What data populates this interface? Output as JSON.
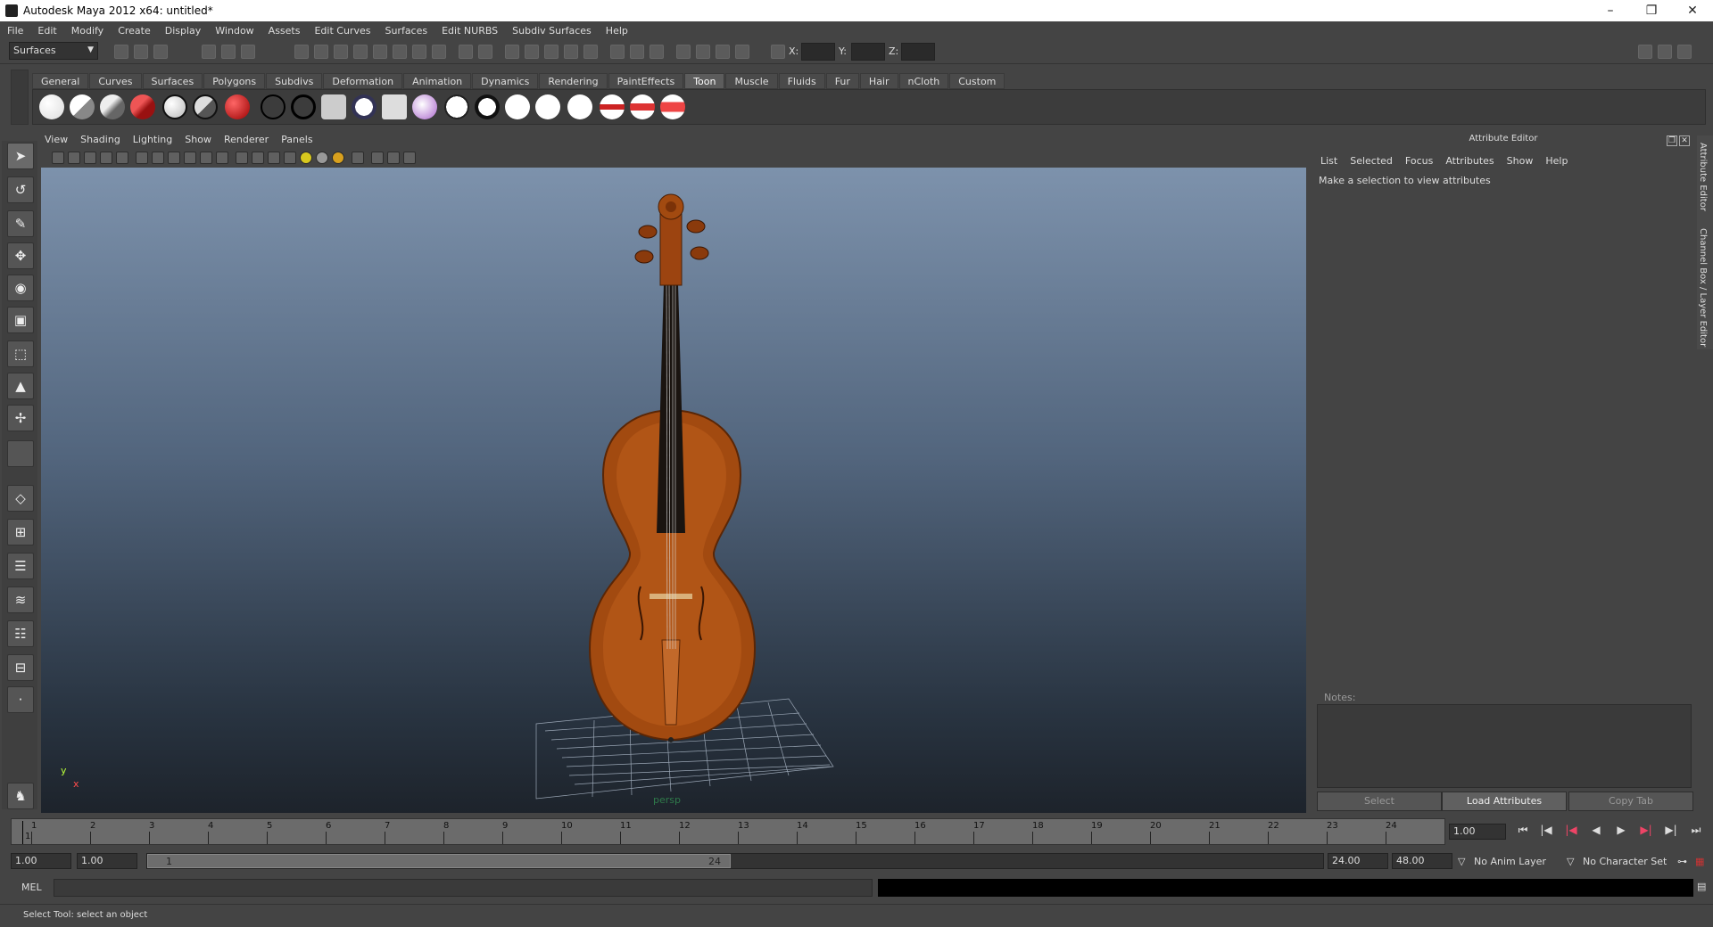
{
  "window": {
    "title": "Autodesk Maya 2012 x64: untitled*",
    "minimize": "–",
    "restore": "❐",
    "close": "✕"
  },
  "menubar": [
    "File",
    "Edit",
    "Modify",
    "Create",
    "Display",
    "Window",
    "Assets",
    "Edit Curves",
    "Surfaces",
    "Edit NURBS",
    "Subdiv Surfaces",
    "Help"
  ],
  "statusline": {
    "menu_set": "Surfaces",
    "x_label": "X:",
    "y_label": "Y:",
    "z_label": "Z:"
  },
  "shelf": {
    "tabs": [
      "General",
      "Curves",
      "Surfaces",
      "Polygons",
      "Subdivs",
      "Deformation",
      "Animation",
      "Dynamics",
      "Rendering",
      "PaintEffects",
      "Toon",
      "Muscle",
      "Fluids",
      "Fur",
      "Hair",
      "nCloth",
      "Custom"
    ],
    "active_tab": "Toon"
  },
  "viewport": {
    "menu": [
      "View",
      "Shading",
      "Lighting",
      "Show",
      "Renderer",
      "Panels"
    ],
    "camera": "persp",
    "axis_y": "y",
    "axis_x": "x"
  },
  "attribute_editor": {
    "title": "Attribute Editor",
    "menu": [
      "List",
      "Selected",
      "Focus",
      "Attributes",
      "Show",
      "Help"
    ],
    "message": "Make a selection to view attributes",
    "notes_label": "Notes:",
    "select_button": "Select",
    "load_button": "Load Attributes",
    "copy_button": "Copy Tab",
    "side_tabs": [
      "Attribute Editor",
      "Channel Box / Layer Editor"
    ]
  },
  "timeline": {
    "ticks": [
      "1",
      "2",
      "3",
      "4",
      "5",
      "6",
      "7",
      "8",
      "9",
      "10",
      "11",
      "12",
      "13",
      "14",
      "15",
      "16",
      "17",
      "18",
      "19",
      "20",
      "21",
      "22",
      "23",
      "24"
    ],
    "current_frame": "1",
    "current_time_field": "1.00"
  },
  "range": {
    "start_time": "1.00",
    "playback_start": "1.00",
    "slider_start": "1",
    "slider_end": "24",
    "playback_end": "24.00",
    "end_time": "48.00",
    "anim_layer": "No Anim Layer",
    "character_set": "No Character Set"
  },
  "command_line": {
    "label": "MEL"
  },
  "help_line": {
    "text": "Select Tool: select an object"
  }
}
